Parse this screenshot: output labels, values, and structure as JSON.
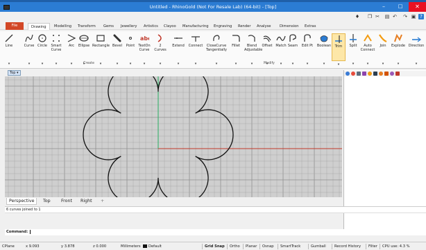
{
  "window": {
    "title": "Untitled - RhinoGold (Not For Resale Lab) (64-bit) - [Top]",
    "minimize": "–",
    "maximize": "□",
    "close": "✕"
  },
  "ribbon_tabs": [
    "File",
    "Drawing",
    "Modelling",
    "Transform",
    "Gems",
    "Jewellery",
    "Artistics",
    "Clayoo",
    "Manufacturing",
    "Engraving",
    "Render",
    "Analyse",
    "Dimension",
    "Extras"
  ],
  "active_tab": "Drawing",
  "ribbon_buttons": [
    {
      "label": "Line",
      "icon": "line-icon"
    },
    {
      "label": "Curve",
      "icon": "curve-icon"
    },
    {
      "label": "Circle",
      "icon": "circle-icon"
    },
    {
      "label": "Smart Curve",
      "icon": "smart-curve-icon"
    },
    {
      "label": "Arc",
      "icon": "arc-icon"
    },
    {
      "label": "Ellipse",
      "icon": "ellipse-icon"
    },
    {
      "label": "Rectangle",
      "icon": "rectangle-icon"
    },
    {
      "label": "Bevel",
      "icon": "bevel-icon"
    },
    {
      "label": "Point",
      "icon": "point-icon"
    },
    {
      "label": "TextOn Curve",
      "icon": "text-on-curve-icon"
    },
    {
      "label": "2 Curves",
      "icon": "two-curves-icon"
    },
    {
      "label": "Extend",
      "icon": "extend-icon"
    },
    {
      "label": "Connect",
      "icon": "connect-icon"
    },
    {
      "label": "CloseCurve Tangentially",
      "icon": "close-curve-icon"
    },
    {
      "label": "Fillet",
      "icon": "fillet-icon"
    },
    {
      "label": "Blend Adjustable",
      "icon": "blend-icon"
    },
    {
      "label": "Offset",
      "icon": "offset-icon"
    },
    {
      "label": "Match",
      "icon": "match-icon"
    },
    {
      "label": "Seam",
      "icon": "seam-icon"
    },
    {
      "label": "Edit Pt",
      "icon": "edit-point-icon"
    },
    {
      "label": "Boolean",
      "icon": "boolean-icon"
    },
    {
      "label": "Trim",
      "icon": "trim-icon"
    },
    {
      "label": "Split",
      "icon": "split-icon"
    },
    {
      "label": "Auto Connect",
      "icon": "auto-connect-icon"
    },
    {
      "label": "Join",
      "icon": "join-icon"
    },
    {
      "label": "Explode",
      "icon": "explode-icon"
    },
    {
      "label": "Direction",
      "icon": "direction-icon"
    }
  ],
  "ribbon_groups": {
    "create": "Create",
    "modify": "Modify"
  },
  "dropdown_arrow": "▾",
  "viewport_label": "Top",
  "viewport_tabs": [
    "Perspective",
    "Top",
    "Front",
    "Right"
  ],
  "add_viewport_glyph": "+",
  "command_history": "6 curves joined to 1",
  "command": {
    "label": "Command:",
    "value": ""
  },
  "status": {
    "cplane": "CPlane",
    "x": "x 9.093",
    "y": "y 3.878",
    "z": "z 0.000",
    "units": "Millimeters",
    "layer": "Default",
    "toggles": [
      "Grid Snap",
      "Ortho",
      "Planar",
      "Osnap",
      "SmartTrack",
      "Gumball",
      "Record History",
      "Filter"
    ],
    "cpu": "CPU use: 4.3 %"
  },
  "colors": {
    "title_bar": "#2b7cd3",
    "file_tab": "#d24726",
    "close_button": "#e81123",
    "grid_line": "#a9a9a9",
    "grid_major": "#8f8f8f",
    "x_axis": "#c0392b",
    "y_axis": "#27ae60",
    "trim_highlight": "#fde7a8"
  }
}
